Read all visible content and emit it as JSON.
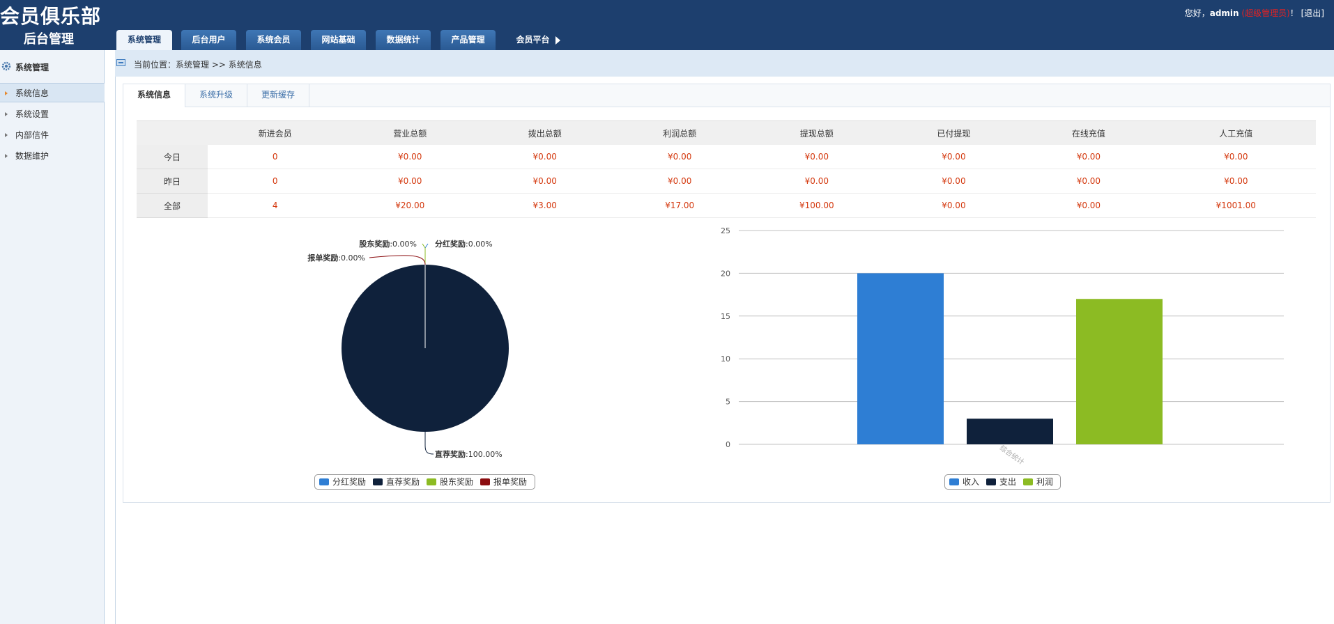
{
  "header": {
    "logo_line1": "会员俱乐部",
    "logo_line2": "后台管理",
    "greeting": "您好，",
    "username": "admin",
    "role": "(超级管理员)",
    "exclaim": "！",
    "logout": "[退出]"
  },
  "nav": {
    "tabs": [
      {
        "label": "系统管理",
        "active": true
      },
      {
        "label": "后台用户"
      },
      {
        "label": "系统会员"
      },
      {
        "label": "网站基础"
      },
      {
        "label": "数据统计"
      },
      {
        "label": "产品管理"
      },
      {
        "label": "会员平台"
      }
    ]
  },
  "sidebar": {
    "title": "系统管理",
    "title_icon": "gear-icon",
    "items": [
      {
        "label": "系统信息",
        "active": true
      },
      {
        "label": "系统设置"
      },
      {
        "label": "内部信件"
      },
      {
        "label": "数据维护"
      }
    ]
  },
  "breadcrumb": {
    "icon": "window-icon",
    "text": "当前位置：系统管理 >> 系统信息"
  },
  "subtabs": [
    {
      "label": "系统信息",
      "active": true
    },
    {
      "label": "系统升级"
    },
    {
      "label": "更新缓存"
    }
  ],
  "stats": {
    "columns": [
      "新进会员",
      "营业总额",
      "拨出总额",
      "利润总额",
      "提现总额",
      "已付提现",
      "在线充值",
      "人工充值"
    ],
    "rows": [
      {
        "label": "今日",
        "values": [
          "0",
          "¥0.00",
          "¥0.00",
          "¥0.00",
          "¥0.00",
          "¥0.00",
          "¥0.00",
          "¥0.00"
        ]
      },
      {
        "label": "昨日",
        "values": [
          "0",
          "¥0.00",
          "¥0.00",
          "¥0.00",
          "¥0.00",
          "¥0.00",
          "¥0.00",
          "¥0.00"
        ]
      },
      {
        "label": "全部",
        "values": [
          "4",
          "¥20.00",
          "¥3.00",
          "¥17.00",
          "¥100.00",
          "¥0.00",
          "¥0.00",
          "¥1001.00"
        ]
      }
    ]
  },
  "colors": {
    "blue": "#2e7ed4",
    "navy": "#0f213b",
    "green": "#8cbb23",
    "darkred": "#8b0d10"
  },
  "chart_data": [
    {
      "type": "pie",
      "slices": [
        {
          "name": "分红奖励",
          "value": 0.0,
          "label": "0.00%",
          "color": "#2e7ed4"
        },
        {
          "name": "直荐奖励",
          "value": 100.0,
          "label": "100.00%",
          "color": "#0f213b"
        },
        {
          "name": "股东奖励",
          "value": 0.0,
          "label": "0.00%",
          "color": "#8cbb23"
        },
        {
          "name": "报单奖励",
          "value": 0.0,
          "label": "0.00%",
          "color": "#8b0d10"
        }
      ],
      "legend": [
        "分红奖励",
        "直荐奖励",
        "股东奖励",
        "报单奖励"
      ],
      "legend_position": "bottom"
    },
    {
      "type": "bar",
      "categories": [
        "综合统计"
      ],
      "series": [
        {
          "name": "收入",
          "values": [
            20
          ],
          "color": "#2e7ed4"
        },
        {
          "name": "支出",
          "values": [
            3
          ],
          "color": "#0f213b"
        },
        {
          "name": "利润",
          "values": [
            17
          ],
          "color": "#8cbb23"
        }
      ],
      "ylim": [
        0,
        25
      ],
      "yticks": [
        0,
        5,
        10,
        15,
        20,
        25
      ],
      "grid": true,
      "legend_position": "bottom"
    }
  ]
}
